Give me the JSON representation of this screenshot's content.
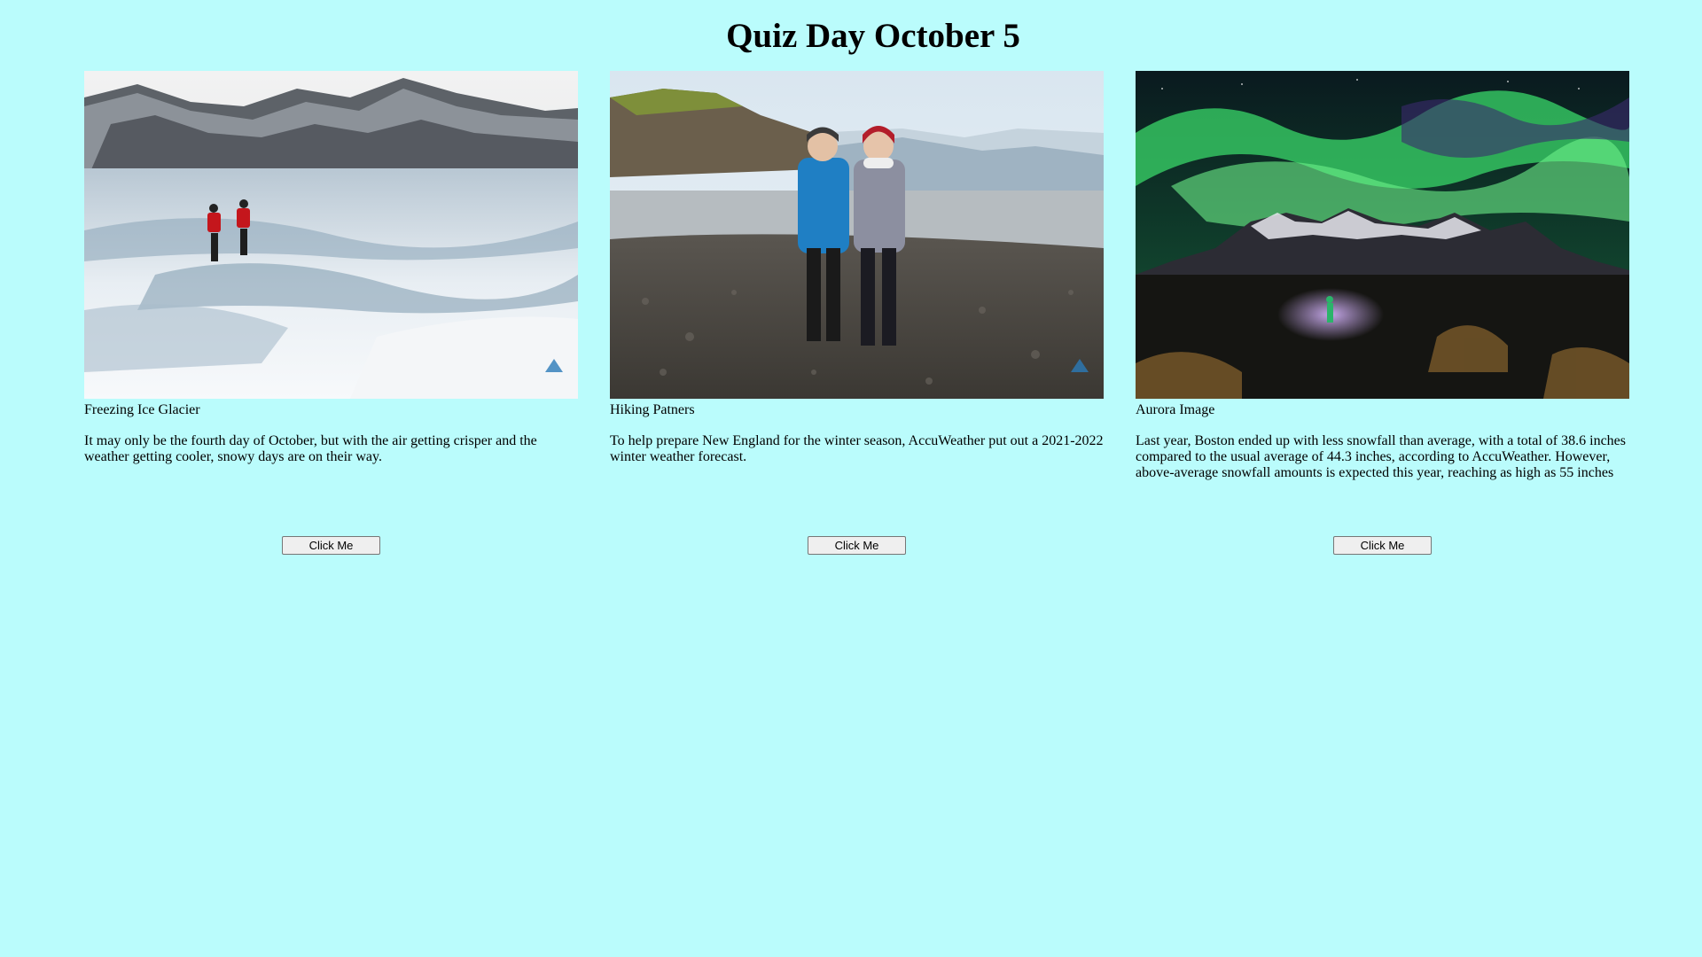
{
  "page": {
    "title": "Quiz Day October 5",
    "background": "#bafcfc"
  },
  "cards": [
    {
      "caption": "Freezing Ice Glacier",
      "description": "It may only be the fourth day of October, but with the air getting crisper and the weather getting cooler, snowy days are on their way.",
      "button_label": "Click Me"
    },
    {
      "caption": "Hiking Patners",
      "description": "To help prepare New England for the winter season, AccuWeather put out a 2021-2022 winter weather forecast.",
      "button_label": "Click Me"
    },
    {
      "caption": "Aurora Image",
      "description": "Last year, Boston ended up with less snowfall than average, with a total of 38.6 inches compared to the usual average of 44.3 inches, according to AccuWeather. However, above-average snowfall amounts is expected this year, reaching as high as 55 inches",
      "button_label": "Click Me"
    }
  ]
}
